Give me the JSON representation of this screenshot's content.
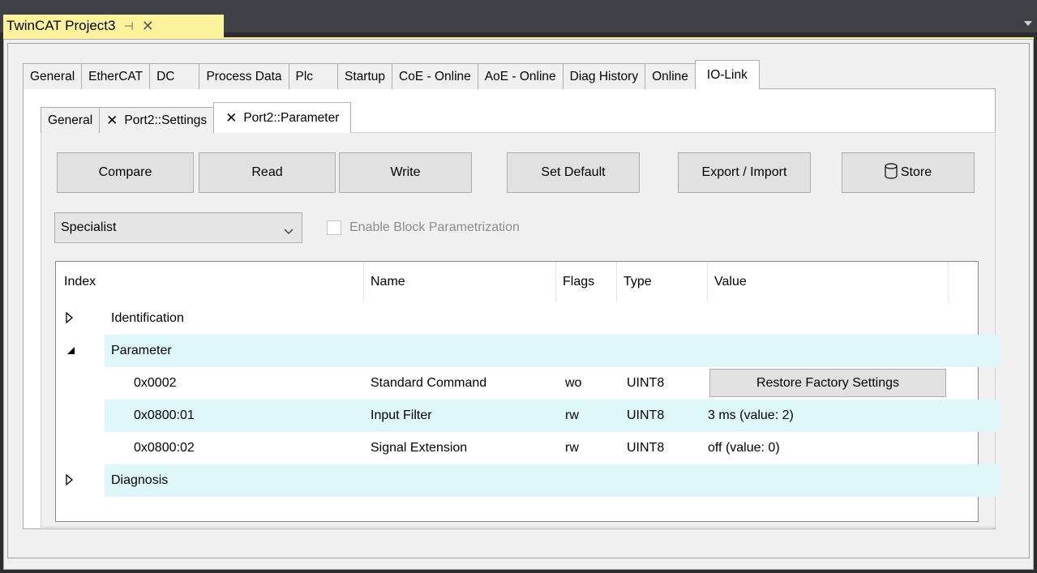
{
  "document": {
    "title": "TwinCAT Project3",
    "pin_glyph": "⊣",
    "close_glyph": "✕"
  },
  "main_tabs": [
    {
      "label": "General"
    },
    {
      "label": "EtherCAT"
    },
    {
      "label": "DC"
    },
    {
      "label": "Process Data"
    },
    {
      "label": "Plc"
    },
    {
      "label": "Startup"
    },
    {
      "label": "CoE - Online"
    },
    {
      "label": "AoE - Online"
    },
    {
      "label": "Diag History"
    },
    {
      "label": "Online"
    },
    {
      "label": "IO-Link",
      "active": true
    }
  ],
  "sub_tabs": [
    {
      "label": "General"
    },
    {
      "label": "Port2::Settings",
      "closable": true
    },
    {
      "label": "Port2::Parameter",
      "closable": true,
      "active": true
    }
  ],
  "toolbar": {
    "compare": "Compare",
    "read": "Read",
    "write": "Write",
    "set_default": "Set Default",
    "export_import": "Export / Import",
    "store": "Store"
  },
  "mode_select": {
    "value": "Specialist"
  },
  "block_param": {
    "label": "Enable Block Parametrization",
    "checked": false,
    "enabled": false
  },
  "table": {
    "columns": [
      "Index",
      "Name",
      "Flags",
      "Type",
      "Value"
    ],
    "groups": [
      {
        "label": "Identification",
        "expanded": false
      },
      {
        "label": "Parameter",
        "expanded": true
      },
      {
        "label": "Diagnosis",
        "expanded": false
      }
    ],
    "rows": [
      {
        "index": "0x0002",
        "name": "Standard Command",
        "flags": "wo",
        "type": "UINT8",
        "value": "Restore Factory Settings",
        "value_is_button": true
      },
      {
        "index": "0x0800:01",
        "name": "Input Filter",
        "flags": "rw",
        "type": "UINT8",
        "value": "3 ms (value: 2)"
      },
      {
        "index": "0x0800:02",
        "name": "Signal Extension",
        "flags": "rw",
        "type": "UINT8",
        "value": "off (value: 0)"
      }
    ]
  },
  "colors": {
    "accent_tab": "#fff29d",
    "row_highlight": "#def7fa",
    "frame": "#2d2d30"
  }
}
